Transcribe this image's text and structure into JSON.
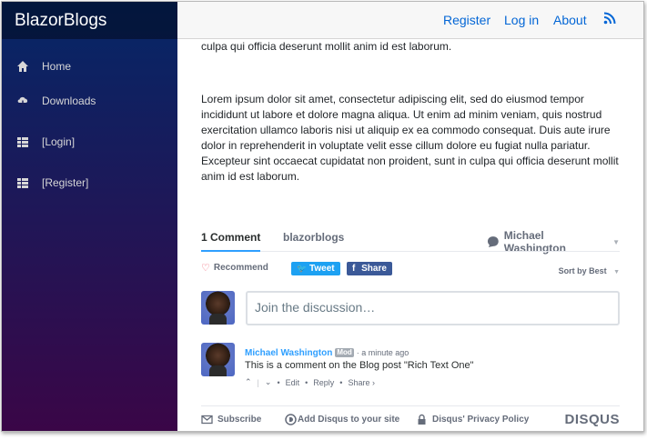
{
  "sidebar": {
    "brand": "BlazorBlogs",
    "items": [
      {
        "label": "Home",
        "icon": "home-icon"
      },
      {
        "label": "Downloads",
        "icon": "cloud-download-icon"
      },
      {
        "label": "[Login]",
        "icon": "list-icon"
      },
      {
        "label": "[Register]",
        "icon": "list-icon"
      }
    ]
  },
  "topbar": {
    "register": "Register",
    "login": "Log in",
    "about": "About",
    "rss_icon": "rss-icon"
  },
  "post": {
    "line_top": "culpa qui officia deserunt mollit anim id est laborum.",
    "paragraph": "Lorem ipsum dolor sit amet, consectetur adipiscing elit, sed do eiusmod tempor incididunt ut labore et dolore magna aliqua. Ut enim ad minim veniam, quis nostrud exercitation ullamco laboris nisi ut aliquip ex ea commodo consequat. Duis aute irure dolor in reprehenderit in voluptate velit esse cillum dolore eu fugiat nulla pariatur. Excepteur sint occaecat cupidatat non proident, sunt in culpa qui officia deserunt mollit anim id est laborum."
  },
  "disqus": {
    "tab_comments": "1 Comment",
    "tab_site": "blazorblogs",
    "user": "Michael Washington",
    "recommend": "Recommend",
    "tweet": "Tweet",
    "share": "Share",
    "sort": "Sort by Best",
    "placeholder": "Join the discussion…",
    "comment": {
      "author": "Michael Washington",
      "badge": "Mod",
      "time": "a minute ago",
      "text": "This is a comment on the Blog post \"Rich Text One\"",
      "edit": "Edit",
      "reply": "Reply",
      "share": "Share ›"
    },
    "footer": {
      "subscribe": "Subscribe",
      "add": "Add Disqus to your site",
      "privacy": "Disqus' Privacy Policy",
      "logo": "DISQUS"
    }
  },
  "colors": {
    "link": "#0366d6",
    "disqus_blue": "#2e9fff",
    "twitter": "#1da1f2",
    "facebook": "#3b5998"
  }
}
